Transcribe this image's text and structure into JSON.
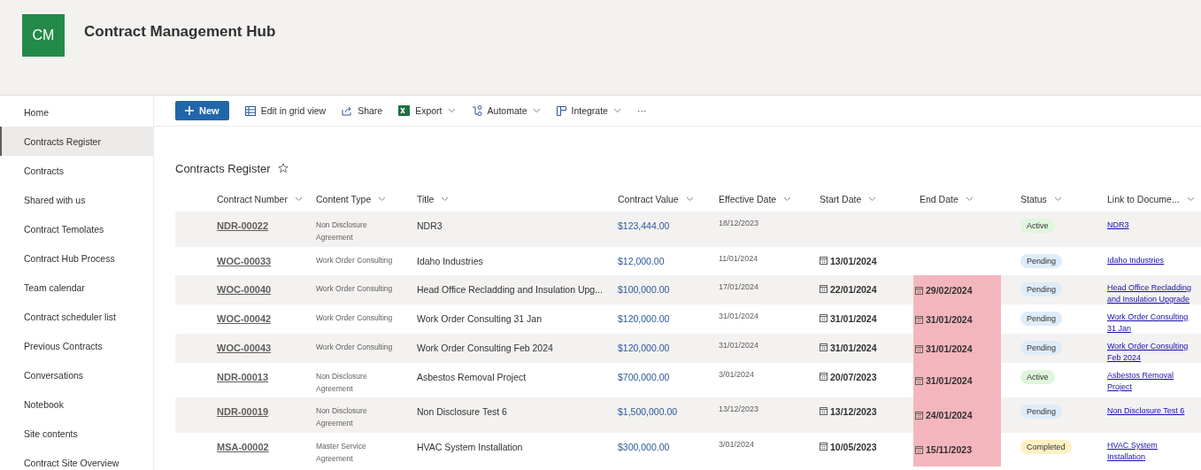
{
  "site": {
    "logo": "CM",
    "title": "Contract Management Hub"
  },
  "nav": [
    {
      "label": "Home",
      "selected": false
    },
    {
      "label": "Contracts Register",
      "selected": true
    },
    {
      "label": "Contracts",
      "selected": false
    },
    {
      "label": "Shared with us",
      "selected": false
    },
    {
      "label": "Contract Temolates",
      "selected": false
    },
    {
      "label": "Contract Hub Process",
      "selected": false
    },
    {
      "label": "Team calendar",
      "selected": false
    },
    {
      "label": "Contract scheduler list",
      "selected": false
    },
    {
      "label": "Previous Contracts",
      "selected": false
    },
    {
      "label": "Conversations",
      "selected": false
    },
    {
      "label": "Notebook",
      "selected": false
    },
    {
      "label": "Site contents",
      "selected": false
    },
    {
      "label": "Contract Site Overview",
      "selected": false
    }
  ],
  "toolbar": [
    {
      "kind": "primary",
      "label": "New"
    },
    {
      "kind": "grid",
      "label": "Edit in grid view"
    },
    {
      "kind": "share",
      "label": "Share"
    },
    {
      "kind": "excel",
      "label": "Export"
    },
    {
      "kind": "flow",
      "label": "Automate"
    },
    {
      "kind": "integrate",
      "label": "Integrate"
    },
    {
      "kind": "more",
      "label": "···"
    }
  ],
  "list_title": "Contracts Register",
  "table": {
    "columns": [
      "Contract Number",
      "Content Type",
      "Title",
      "Contract Value",
      "Effective Date",
      "Start Date",
      "End Date",
      "Status",
      "Link to Docume..."
    ],
    "rows": [
      {
        "number": "NDR-00022",
        "type": "Non Disclosure Agreement",
        "title": "NDR3",
        "value": "$123,444.00",
        "effective": "18/12/2023",
        "start": "",
        "end": "",
        "status": "Active",
        "color": "#dff6dd",
        "link": "NDR3"
      },
      {
        "number": "WOC-00033",
        "type": "Work Order Consulting",
        "title": "Idaho Industries",
        "value": "$12,000.00",
        "effective": "11/01/2024",
        "start": "13/01/2024",
        "end": "",
        "status": "Pending",
        "color": "#deecf9",
        "link": "Idaho Industries"
      },
      {
        "number": "WOC-00040",
        "type": "Work Order Consulting",
        "title": "Head Office Recladding and Insulation Upg...",
        "value": "$100,000.00",
        "effective": "17/01/2024",
        "start": "22/01/2024",
        "end": "29/02/2024",
        "overdue": true,
        "status": "Pending",
        "color": "#deecf9",
        "link": "Head Office Recladding and Insulation Upgrade"
      },
      {
        "number": "WOC-00042",
        "type": "Work Order Consulting",
        "title": "Work Order Consulting 31 Jan",
        "value": "$120,000.00",
        "effective": "31/01/2024",
        "start": "31/01/2024",
        "end": "31/01/2024",
        "overdue": true,
        "status": "Pending",
        "color": "#deecf9",
        "link": "Work Order Consulting 31 Jan"
      },
      {
        "number": "WOC-00043",
        "type": "Work Order Consulting",
        "title": "Work Order Consulting Feb 2024",
        "value": "$120,000.00",
        "effective": "31/01/2024",
        "start": "31/01/2024",
        "end": "31/01/2024",
        "overdue": true,
        "status": "Pending",
        "color": "#deecf9",
        "link": "Work Order Consulting Feb 2024"
      },
      {
        "number": "NDR-00013",
        "type": "Non Disclosure Agreement",
        "title": "Asbestos Removal Project",
        "value": "$700,000.00",
        "effective": "3/01/2024",
        "start": "20/07/2023",
        "end": "31/01/2024",
        "overdue": true,
        "status": "Active",
        "color": "#dff6dd",
        "link": "Asbestos Removal Project"
      },
      {
        "number": "NDR-00019",
        "type": "Non Disclosure Agreement",
        "title": "Non Disclosure Test 6",
        "value": "$1,500,000.00",
        "effective": "13/12/2023",
        "start": "13/12/2023",
        "end": "24/01/2024",
        "overdue": true,
        "status": "Pending",
        "color": "#deecf9",
        "link": "Non Disclosure Test 6"
      },
      {
        "number": "MSA-00002",
        "type": "Master Service Agreement",
        "title": "HVAC System Installation",
        "value": "$300,000.00",
        "effective": "3/01/2024",
        "start": "10/05/2023",
        "end": "15/11/2023",
        "overdue": true,
        "status": "Completed",
        "color": "#fff1c4",
        "link": "HVAC System Installation"
      }
    ]
  }
}
